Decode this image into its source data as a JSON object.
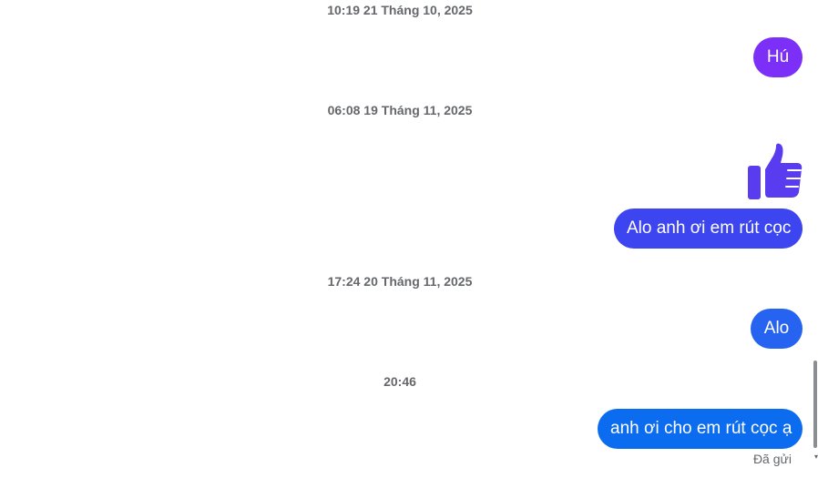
{
  "messages": [
    {
      "timestamp": "10:19 21 Tháng 10, 2025",
      "text": "Hú",
      "color": "#7b2ff7"
    },
    {
      "timestamp": "06:08 19 Tháng 11, 2025",
      "reaction": "thumbs-up-icon",
      "text": "Alo anh ơi em rút cọc",
      "color": "#3c45f0"
    },
    {
      "timestamp": "17:24 20 Tháng 11, 2025",
      "text": "Alo",
      "color": "#2563f0"
    },
    {
      "timestamp": "20:46",
      "text": "anh ơi cho em rút cọc ạ",
      "color": "#0b6cf0"
    }
  ],
  "status": "Đã gửi",
  "colors": {
    "like": "#5a3cf0",
    "timestamp": "#65676b"
  },
  "scrollbar": {
    "arrow": "▾"
  }
}
